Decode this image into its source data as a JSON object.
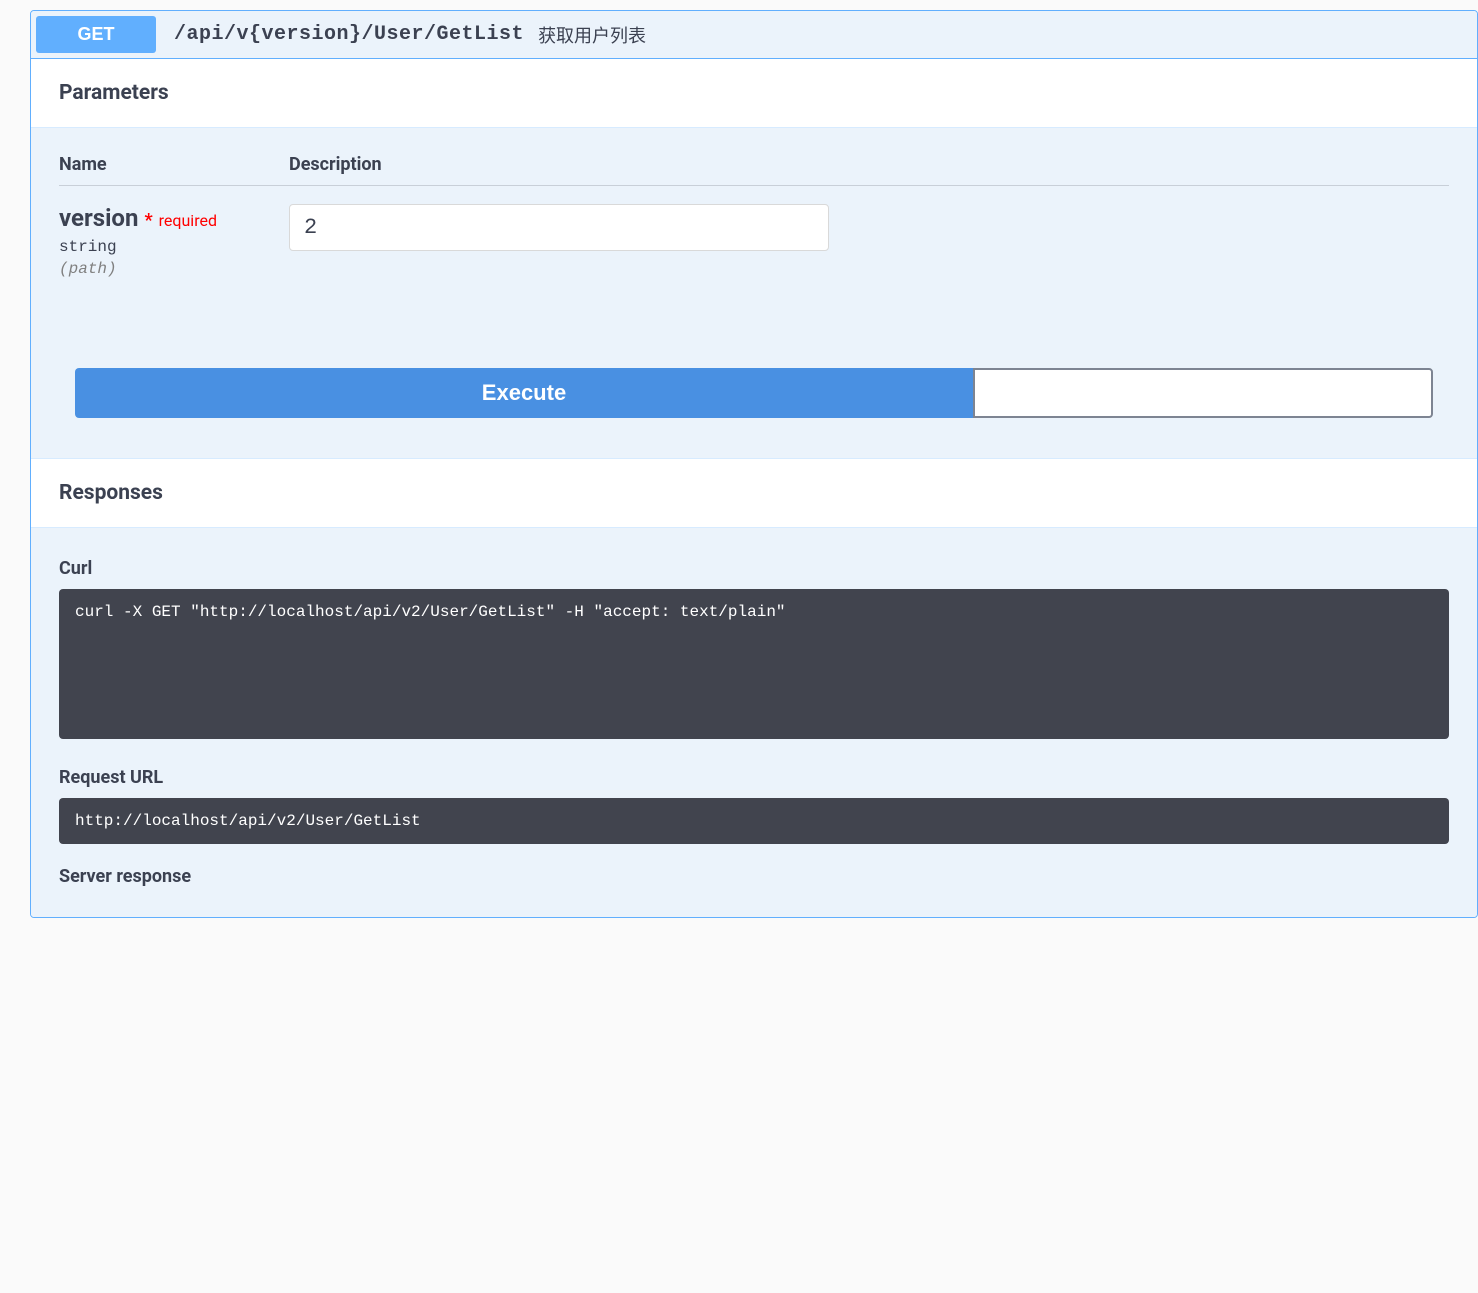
{
  "summary": {
    "method": "GET",
    "path": "/api/v{version}/User/GetList",
    "description": "获取用户列表"
  },
  "sections": {
    "parameters_title": "Parameters",
    "responses_title": "Responses"
  },
  "param_columns": {
    "name": "Name",
    "description": "Description"
  },
  "param": {
    "name": "version",
    "star": "*",
    "required_label": "required",
    "type": "string",
    "in_label": "(path)",
    "value": "2"
  },
  "buttons": {
    "execute": "Execute"
  },
  "responses": {
    "curl_heading": "Curl",
    "curl_text": "curl -X GET \"http://localhost/api/v2/User/GetList\" -H \"accept: text/plain\"",
    "request_url_heading": "Request URL",
    "request_url_text": "http://localhost/api/v2/User/GetList",
    "server_response_heading": "Server response"
  }
}
